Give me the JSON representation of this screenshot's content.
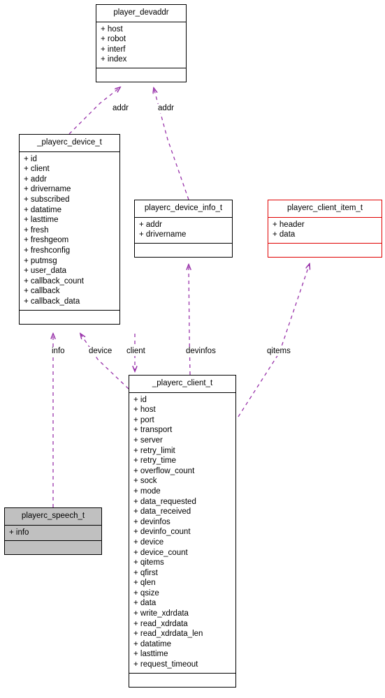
{
  "diagram": {
    "type": "uml-class-collaboration-diagram",
    "edge_color": "#9933aa",
    "focus_border_color": "#e00000",
    "default_border_color": "#000000",
    "shaded_fill_color": "#c0c0c0",
    "classes": [
      {
        "id": "player_devaddr",
        "name": "player_devaddr",
        "style": "plain",
        "attributes": [
          "+ host",
          "+ robot",
          "+ interf",
          "+ index"
        ],
        "operations": []
      },
      {
        "id": "playerc_device_t",
        "name": "_playerc_device_t",
        "style": "plain",
        "attributes": [
          "+ id",
          "+ client",
          "+ addr",
          "+ drivername",
          "+ subscribed",
          "+ datatime",
          "+ lasttime",
          "+ fresh",
          "+ freshgeom",
          "+ freshconfig",
          "+ putmsg",
          "+ user_data",
          "+ callback_count",
          "+ callback",
          "+ callback_data"
        ],
        "operations": []
      },
      {
        "id": "playerc_device_info_t",
        "name": "playerc_device_info_t",
        "style": "plain",
        "attributes": [
          "+ addr",
          "+ drivername"
        ],
        "operations": []
      },
      {
        "id": "playerc_client_item_t",
        "name": "playerc_client_item_t",
        "style": "focus",
        "attributes": [
          "+ header",
          "+ data"
        ],
        "operations": []
      },
      {
        "id": "playerc_client_t",
        "name": "_playerc_client_t",
        "style": "plain",
        "attributes": [
          "+ id",
          "+ host",
          "+ port",
          "+ transport",
          "+ server",
          "+ retry_limit",
          "+ retry_time",
          "+ overflow_count",
          "+ sock",
          "+ mode",
          "+ data_requested",
          "+ data_received",
          "+ devinfos",
          "+ devinfo_count",
          "+ device",
          "+ device_count",
          "+ qitems",
          "+ qfirst",
          "+ qlen",
          "+ qsize",
          "+ data",
          "+ write_xdrdata",
          "+ read_xdrdata",
          "+ read_xdrdata_len",
          "+ datatime",
          "+ lasttime",
          "+ request_timeout"
        ],
        "operations": []
      },
      {
        "id": "playerc_speech_t",
        "name": "playerc_speech_t",
        "style": "shaded",
        "attributes": [
          "+ info"
        ],
        "operations": []
      }
    ],
    "edges": [
      {
        "id": "edge-addr-device",
        "label": "addr",
        "from": "playerc_device_t",
        "to": "player_devaddr"
      },
      {
        "id": "edge-addr-device-info",
        "label": "addr",
        "from": "playerc_device_info_t",
        "to": "player_devaddr"
      },
      {
        "id": "edge-info",
        "label": "info",
        "from": "playerc_speech_t",
        "to": "playerc_device_t"
      },
      {
        "id": "edge-device",
        "label": "device",
        "from": "playerc_client_t",
        "to": "playerc_device_t"
      },
      {
        "id": "edge-client",
        "label": "client",
        "from": "playerc_device_t",
        "to": "playerc_client_t"
      },
      {
        "id": "edge-devinfos",
        "label": "devinfos",
        "from": "playerc_client_t",
        "to": "playerc_device_info_t"
      },
      {
        "id": "edge-qitems",
        "label": "qitems",
        "from": "playerc_client_t",
        "to": "playerc_client_item_t"
      }
    ],
    "edge_labels": {
      "addr_left": "addr",
      "addr_right": "addr",
      "info": "info",
      "device": "device",
      "client": "client",
      "devinfos": "devinfos",
      "qitems": "qitems"
    }
  }
}
